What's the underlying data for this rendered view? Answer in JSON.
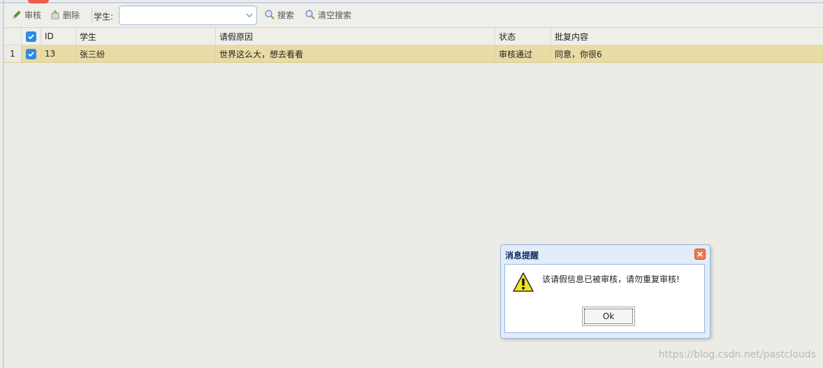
{
  "toolbar": {
    "audit_label": "审核",
    "delete_label": "删除",
    "student_label": "学生:",
    "student_value": "",
    "search_label": "搜索",
    "clear_search_label": "清空搜索"
  },
  "grid": {
    "columns": [
      "ID",
      "学生",
      "请假原因",
      "状态",
      "批复内容"
    ],
    "rows": [
      {
        "rownum": "1",
        "checked": true,
        "id": "13",
        "student": "张三纷",
        "reason": "世界这么大，想去看看",
        "status": "审核通过",
        "reply": "同意，你很6"
      }
    ]
  },
  "dialog": {
    "title": "消息提醒",
    "message": "该请假信息已被审核，请勿重复审核!",
    "ok_label": "Ok"
  },
  "watermark": "https://blog.csdn.net/pastclouds",
  "colors": {
    "selected_row": "#e9dba5",
    "checkbox": "#2d8ae6",
    "dialog_border": "#95b8e7",
    "close_button": "#f07a48"
  }
}
